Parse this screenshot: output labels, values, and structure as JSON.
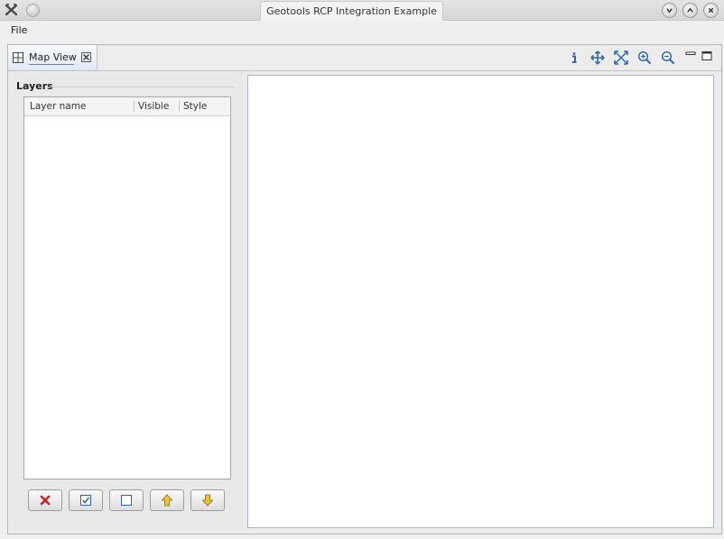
{
  "window": {
    "title": "Geotools RCP Integration Example"
  },
  "menubar": {
    "items": [
      "File"
    ]
  },
  "editor_tab": {
    "label": "Map View"
  },
  "layers_panel": {
    "title": "Layers",
    "columns": [
      "Layer name",
      "Visible",
      "Style"
    ],
    "rows": []
  },
  "colors": {
    "accent": "#4e87c6",
    "map_tool_blue": "#2f67b1",
    "remove_red": "#cc2222",
    "arrow_yellow": "#f2c12e"
  },
  "icons": {
    "map_tools": [
      "info-icon",
      "pan-icon",
      "zoom-extent-icon",
      "zoom-in-icon",
      "zoom-out-icon"
    ],
    "view_controls": [
      "minimize-icon",
      "maximize-icon"
    ],
    "layer_buttons": [
      "remove-layer-icon",
      "show-all-icon",
      "hide-all-icon",
      "move-up-icon",
      "move-down-icon"
    ]
  }
}
